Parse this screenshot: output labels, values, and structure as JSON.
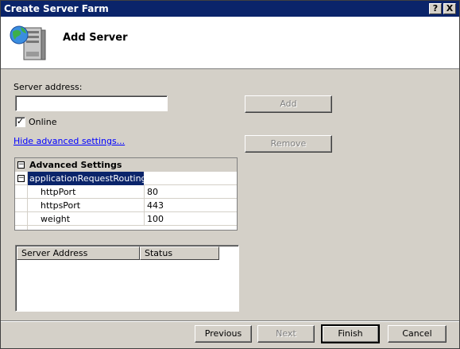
{
  "window": {
    "title": "Create Server Farm",
    "help_button": "?",
    "close_button": "X"
  },
  "header": {
    "title": "Add Server",
    "icon": "server-globe-icon"
  },
  "form": {
    "server_address_label": "Server address:",
    "server_address_value": "",
    "online_label": "Online",
    "online_checked": true,
    "add_button": "Add",
    "remove_button": "Remove",
    "advanced_link": "Hide advanced settings..."
  },
  "advanced": {
    "title": "Advanced Settings",
    "group": "applicationRequestRouting",
    "rows": [
      {
        "name": "httpPort",
        "value": "80"
      },
      {
        "name": "httpsPort",
        "value": "443"
      },
      {
        "name": "weight",
        "value": "100"
      }
    ]
  },
  "server_list": {
    "columns": [
      "Server Address",
      "Status"
    ],
    "rows": []
  },
  "footer": {
    "previous": "Previous",
    "next": "Next",
    "finish": "Finish",
    "cancel": "Cancel"
  },
  "colors": {
    "titlebar": "#0a246a",
    "selection": "#0a246a",
    "link": "#0000ff",
    "dialog_bg": "#d4d0c8"
  }
}
